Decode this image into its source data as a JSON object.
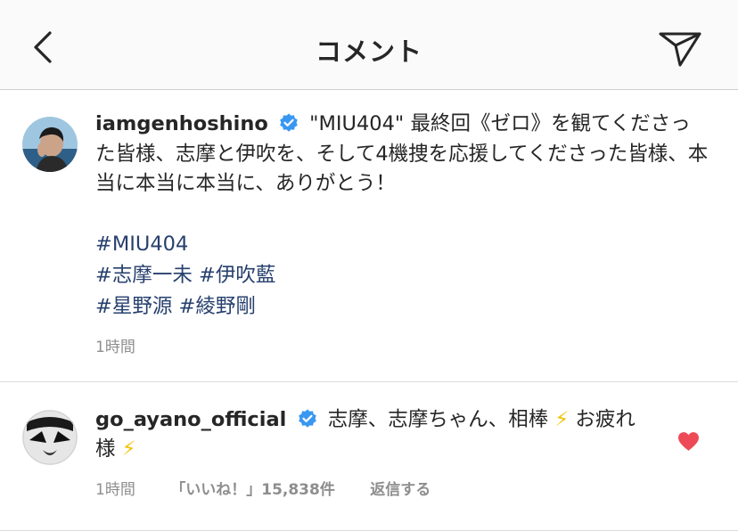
{
  "header": {
    "title": "コメント"
  },
  "post": {
    "username": "iamgenhoshino",
    "text": "\"MIU404\" 最終回《ゼロ》を観てくださった皆様、志摩と伊吹を、そして4機捜を応援してくださった皆様、本当に本当に本当に、ありがとう！",
    "hashtags": {
      "line1": [
        "#MIU404"
      ],
      "line2": [
        "#志摩一未",
        "#伊吹藍"
      ],
      "line3": [
        "#星野源",
        "#綾野剛"
      ]
    },
    "time": "1時間"
  },
  "reply": {
    "username": "go_ayano_official",
    "text_part1": "志摩、志摩ちゃん、相棒",
    "emoji1": "⚡",
    "text_part2": "お疲れ様",
    "emoji2": "⚡",
    "time": "1時間",
    "likes": "「いいね！」15,838件",
    "reply_label": "返信する"
  },
  "colors": {
    "hashtag": "#27406e",
    "verified": "#3897f0",
    "heart": "#ed4956",
    "meta": "#8e8e8e"
  }
}
